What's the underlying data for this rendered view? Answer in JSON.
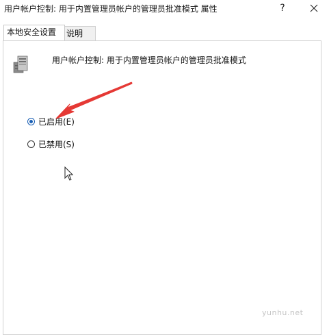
{
  "window": {
    "title": "用户帐户控制: 用于内置管理员帐户的管理员批准模式 属性",
    "help_label": "?"
  },
  "tabs": [
    {
      "label": "本地安全设置",
      "active": true
    },
    {
      "label": "说明",
      "active": false
    }
  ],
  "policy": {
    "name": "用户帐户控制: 用于内置管理员帐户的管理员批准模式",
    "icon": "server-policy-icon"
  },
  "options": {
    "enabled_label": "已启用(E)",
    "disabled_label": "已禁用(S)",
    "selected": "enabled"
  },
  "annotation": {
    "arrow_color": "#e53935"
  },
  "watermark": "yunhu.net"
}
